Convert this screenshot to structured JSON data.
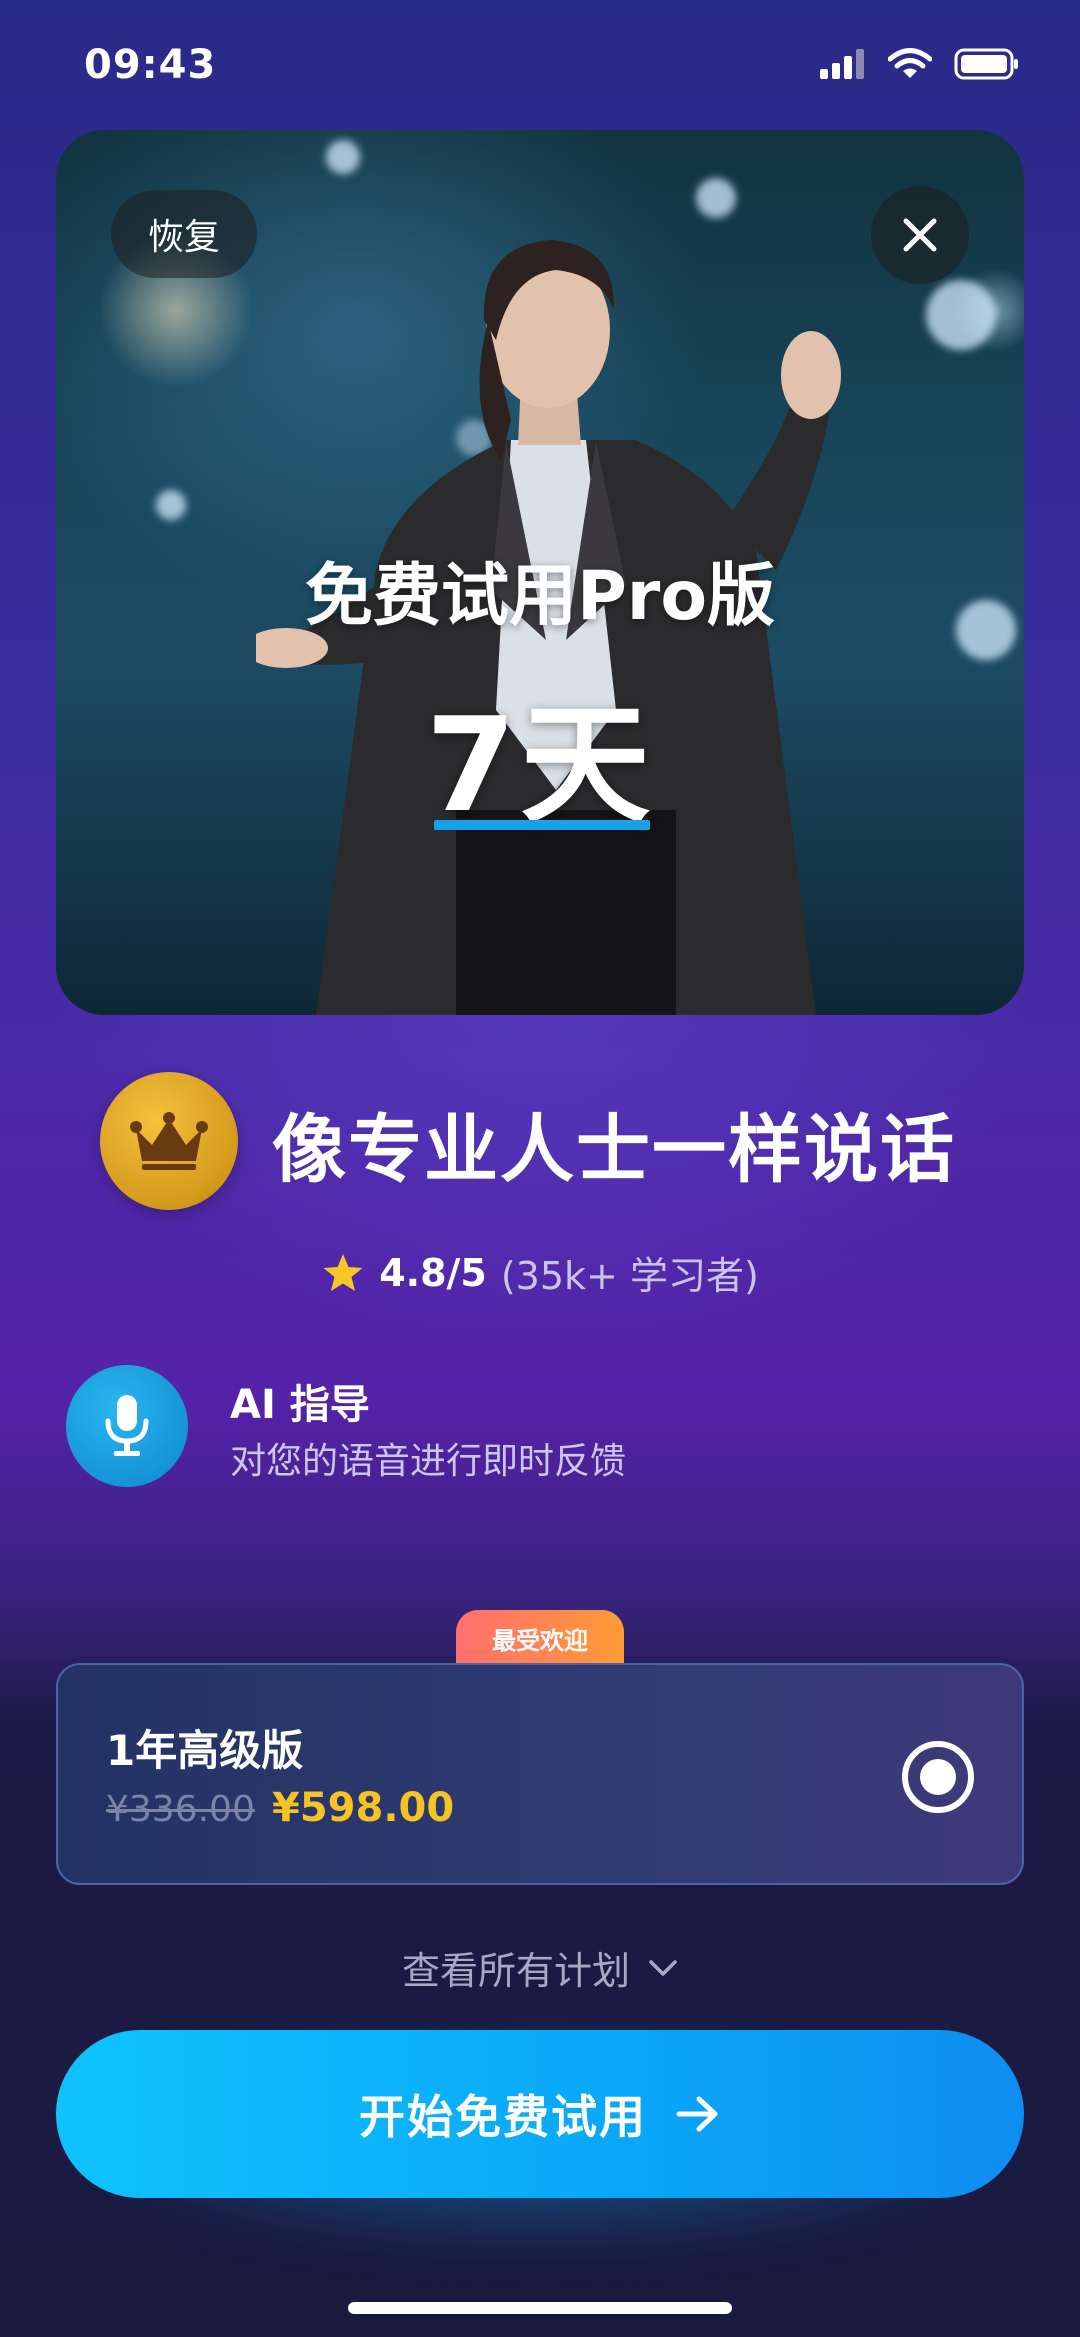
{
  "status_bar": {
    "time": "09:43"
  },
  "hero": {
    "restore_label": "恢复",
    "title": "免费试用Pro版",
    "days": "7天"
  },
  "headline": "像专业人士一样说话",
  "rating": {
    "score": "4.8/5",
    "count": "(35k+ 学习者)"
  },
  "feature": {
    "title": "AI 指导",
    "subtitle": "对您的语音进行即时反馈"
  },
  "plan": {
    "badge": "最受欢迎",
    "name": "1年高级版",
    "original_price": "¥336.00",
    "price": "¥598.00",
    "selected": true
  },
  "view_all_label": "查看所有计划",
  "cta_label": "开始免费试用",
  "colors": {
    "accent_blue": "#0aa6f7",
    "price_yellow": "#f5c322",
    "badge_gradient": [
      "#ff6f6f",
      "#ff9b36"
    ],
    "crown_gold": "#d49a1c"
  },
  "icons": [
    "signal-icon",
    "wifi-icon",
    "battery-icon",
    "close-icon",
    "crown-icon",
    "star-icon",
    "microphone-icon",
    "chevron-down-icon",
    "arrow-right-icon"
  ]
}
